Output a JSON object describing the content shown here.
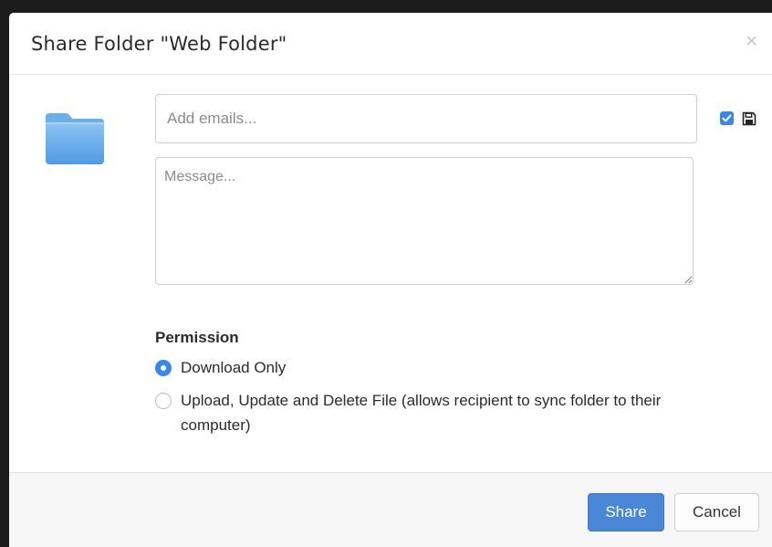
{
  "dialog": {
    "title": "Share Folder \"Web Folder\"",
    "close_glyph": "×"
  },
  "form": {
    "email_placeholder": "Add emails...",
    "email_value": "",
    "message_placeholder": "Message...",
    "message_value": "",
    "save_checkbox_checked": true
  },
  "permission": {
    "label": "Permission",
    "options": [
      {
        "label": "Download Only",
        "selected": true
      },
      {
        "label": "Upload, Update and Delete File (allows recipient to sync folder to their computer)",
        "selected": false
      }
    ]
  },
  "footer": {
    "share_label": "Share",
    "cancel_label": "Cancel"
  },
  "icons": {
    "folder": "folder-icon",
    "close": "close-icon",
    "checkbox": "checkbox-icon",
    "save": "floppy-disk-icon"
  },
  "colors": {
    "accent": "#3a87e6",
    "share_button": "#4a87d6",
    "folder_light": "#8cc4f3",
    "folder_dark": "#4f9be3"
  }
}
